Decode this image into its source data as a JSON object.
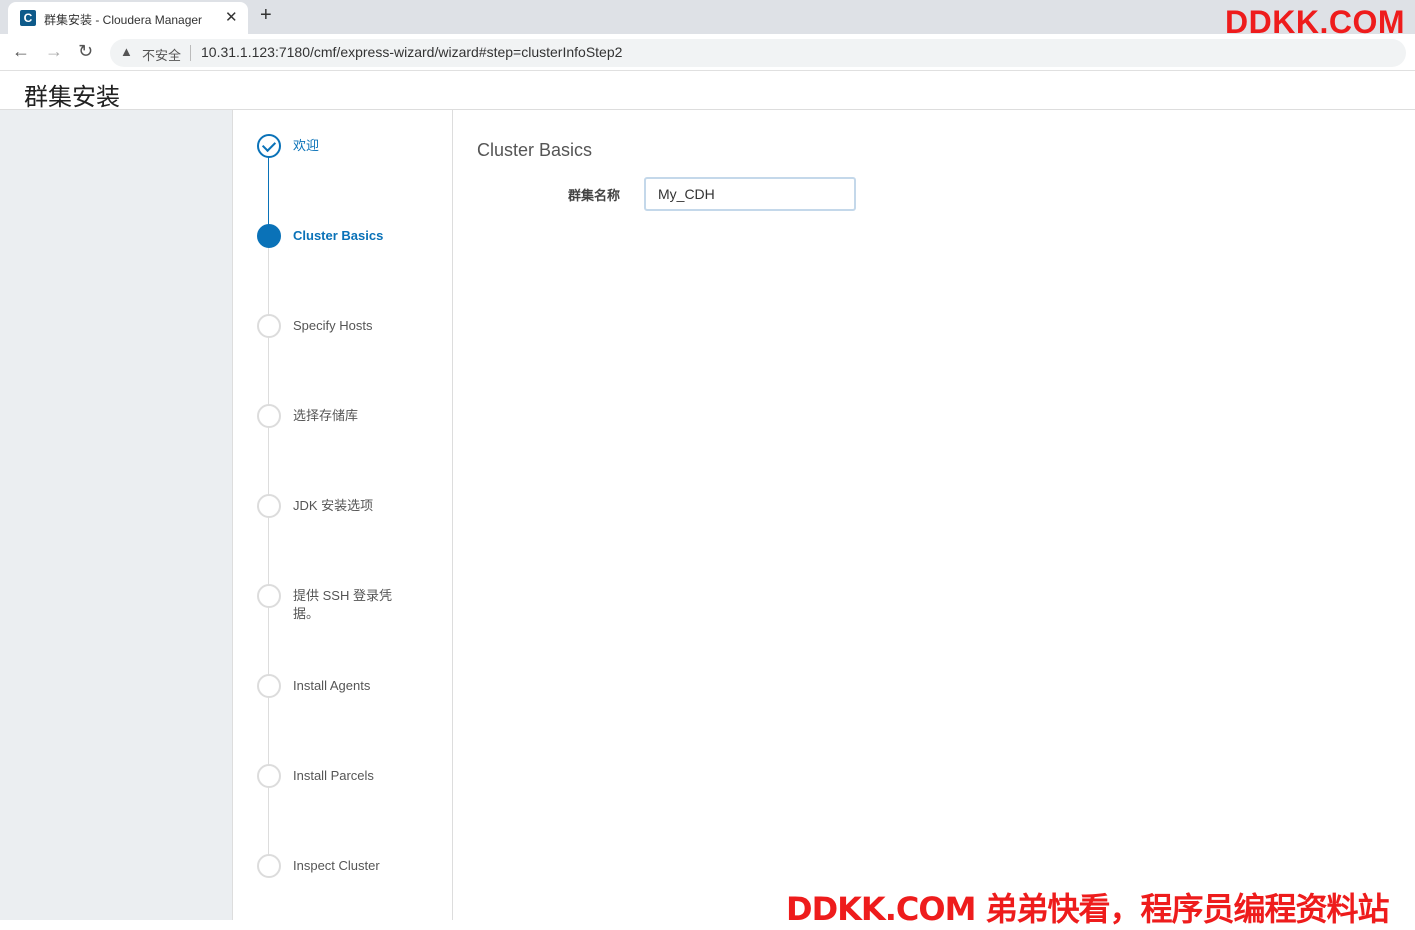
{
  "browser": {
    "tab_title": "群集安装 - Cloudera Manager",
    "favicon_letter": "C",
    "close_glyph": "✕",
    "newtab_glyph": "+",
    "insecure_label": "不安全",
    "url": "10.31.1.123:7180/cmf/express-wizard/wizard#step=clusterInfoStep2"
  },
  "watermark": {
    "top": "DDKK.COM",
    "bottom": "DDKK.COM 弟弟快看，程序员编程资料站"
  },
  "page": {
    "title": "群集安装"
  },
  "steps": [
    {
      "label": "欢迎",
      "state": "done"
    },
    {
      "label": "Cluster Basics",
      "state": "active"
    },
    {
      "label": "Specify Hosts",
      "state": "pending"
    },
    {
      "label": "选择存储库",
      "state": "pending"
    },
    {
      "label": "JDK 安装选项",
      "state": "pending"
    },
    {
      "label": "提供 SSH 登录凭据。",
      "state": "pending"
    },
    {
      "label": "Install Agents",
      "state": "pending"
    },
    {
      "label": "Install Parcels",
      "state": "pending"
    },
    {
      "label": "Inspect Cluster",
      "state": "pending"
    }
  ],
  "main": {
    "section_title": "Cluster Basics",
    "cluster_name_label": "群集名称",
    "cluster_name_value": "My_CDH"
  },
  "colors": {
    "accent": "#0a72b8",
    "watermark": "#ee1c1c"
  }
}
